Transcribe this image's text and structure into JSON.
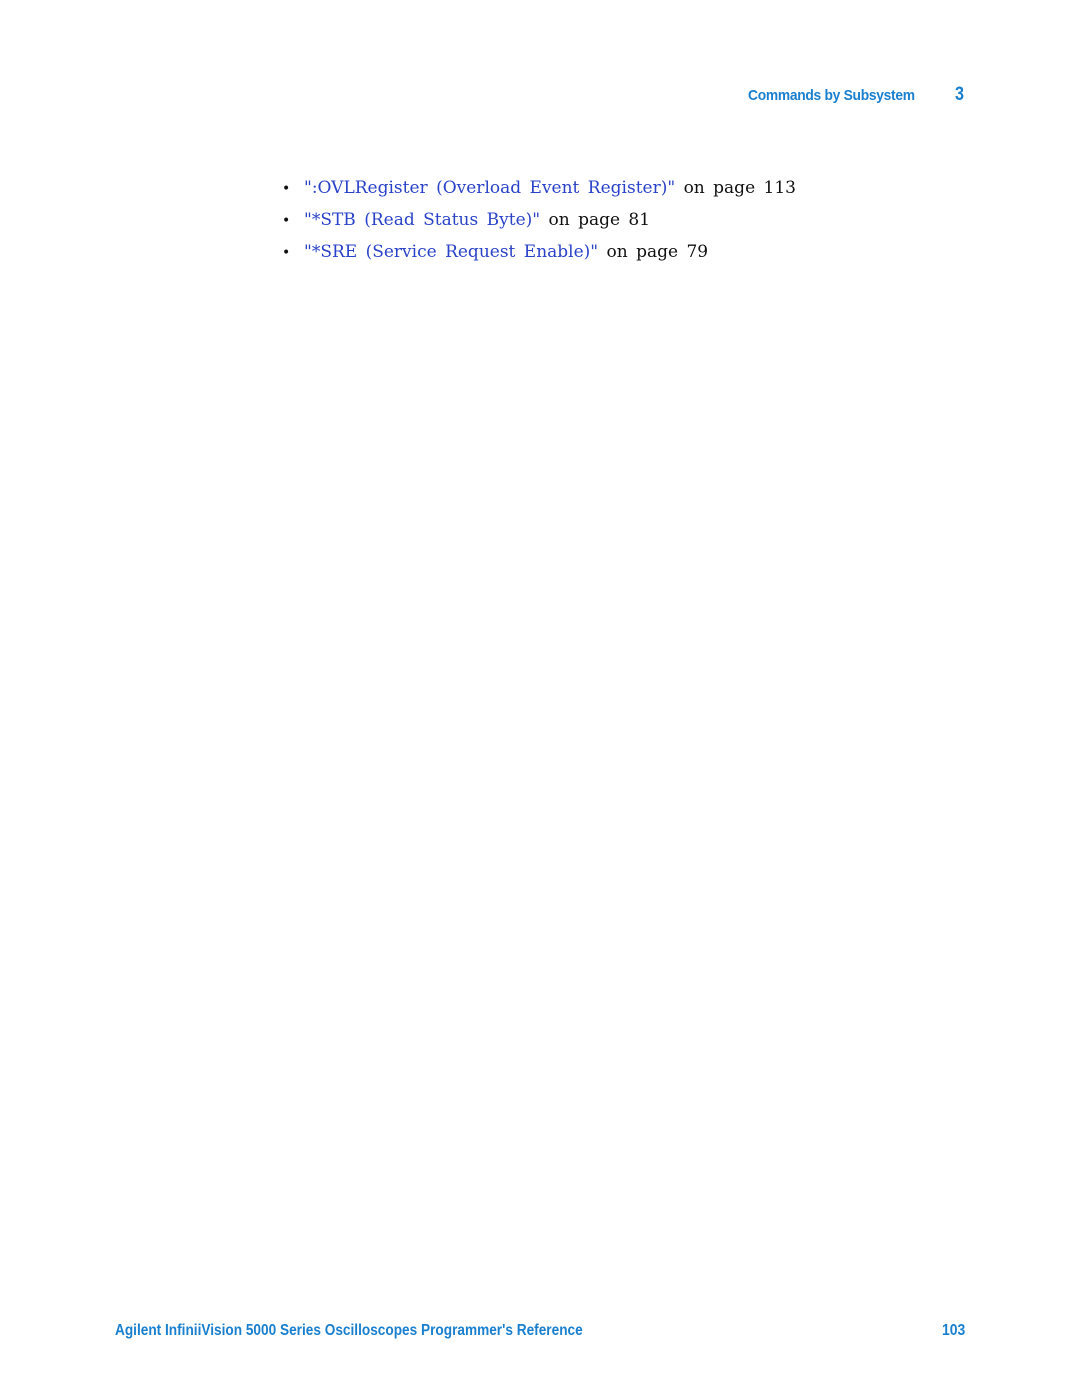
{
  "header": {
    "section_title": "Commands by Subsystem",
    "chapter_number": "3"
  },
  "links": [
    {
      "bullet": "•",
      "link_text": "\":OVLRegister (Overload Event Register)\"",
      "suffix": " on page 113"
    },
    {
      "bullet": "•",
      "link_text": "\"*STB (Read Status Byte)\"",
      "suffix": " on page 81"
    },
    {
      "bullet": "•",
      "link_text": "\"*SRE (Service Request Enable)\"",
      "suffix": " on page 79"
    }
  ],
  "footer": {
    "document_title": "Agilent InfiniiVision 5000 Series Oscilloscopes Programmer's Reference",
    "page_number": "103"
  },
  "colors": {
    "header_blue": "#1a7fcf",
    "link_blue": "#2a42c8",
    "text": "#111111"
  }
}
